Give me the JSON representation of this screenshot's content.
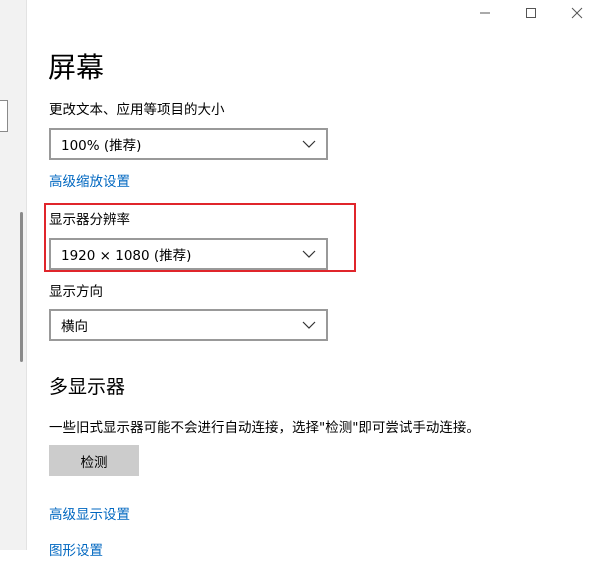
{
  "window": {
    "minimize_icon": "minimize-icon",
    "maximize_icon": "maximize-icon",
    "close_icon": "close-icon"
  },
  "page": {
    "title": "屏幕"
  },
  "scale": {
    "label": "更改文本、应用等项目的大小",
    "value": "100% (推荐)",
    "advanced_link": "高级缩放设置"
  },
  "resolution": {
    "label": "显示器分辨率",
    "value": "1920 × 1080 (推荐)",
    "highlight_color": "#e0252b"
  },
  "orientation": {
    "label": "显示方向",
    "value": "横向"
  },
  "multi_display": {
    "title": "多显示器",
    "description": "一些旧式显示器可能不会进行自动连接，选择\"检测\"即可尝试手动连接。",
    "detect_button": "检测",
    "advanced_link": "高级显示设置",
    "graphics_link": "图形设置"
  },
  "colors": {
    "link": "#0067c0",
    "dropdown_border": "#999999",
    "button_bg": "#cccccc"
  }
}
